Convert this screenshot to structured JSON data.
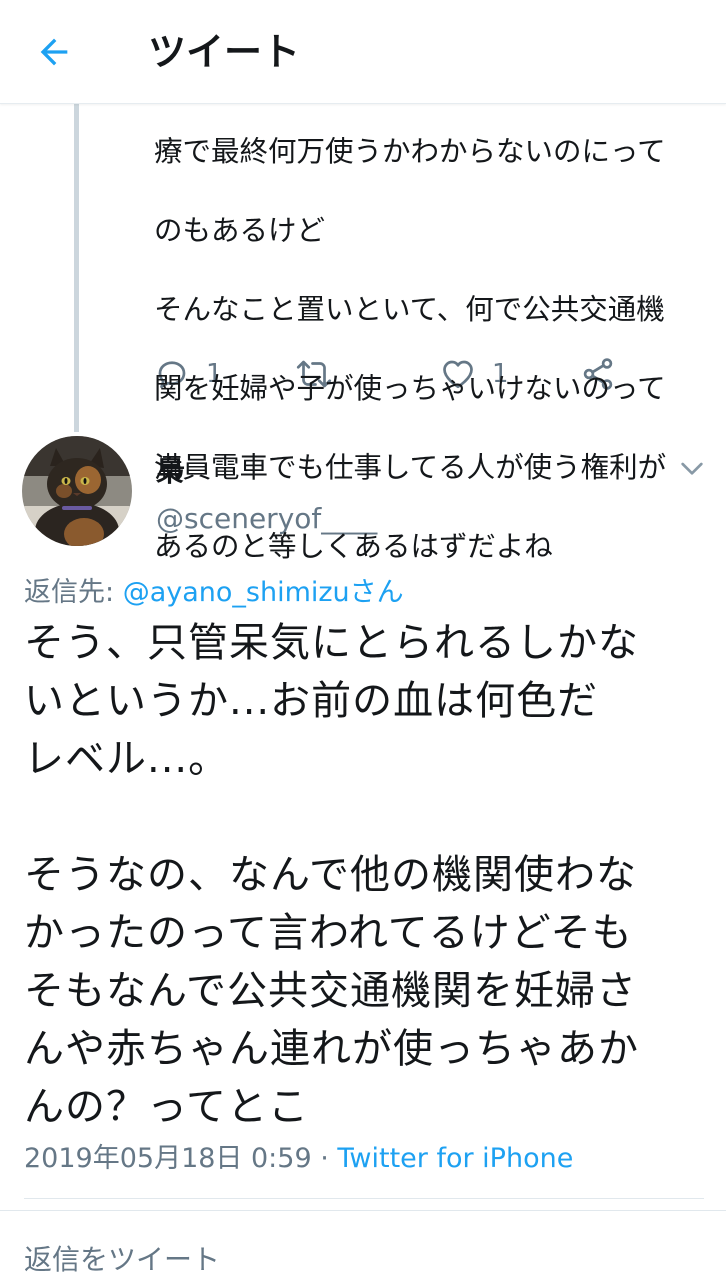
{
  "header": {
    "title": "ツイート",
    "back_icon": "arrow-left-icon",
    "accent_color": "#1da1f2"
  },
  "previous_tweet": {
    "text_lines": [
      "療で最終何万使うかわからないのにって",
      "のもあるけど",
      "そんなこと置いといて、何で公共交通機",
      "関を妊婦や子が使っちゃいけないのって",
      "満員電車でも仕事してる人が使う権利が",
      "あるのと等しくあるはずだよね"
    ],
    "actions": {
      "reply_count": "1",
      "retweet_count": "",
      "like_count": "1"
    }
  },
  "tweet": {
    "display_name": "梟",
    "handle": "@sceneryof____",
    "reply_to_prefix": "返信先: ",
    "reply_to_user": "@ayano_shimizu",
    "reply_to_suffix": "さん",
    "body": "そう、只管呆気にとられるしかな\nいというか...お前の血は何色だ\nレベル...。\n\nそうなの、なんで他の機関使わな\nかったのって言われてるけどそも\nそもなんで公共交通機関を妊婦さ\nんや赤ちゃん連れが使っちゃあか\nんの？ってとこ",
    "timestamp": "2019年05月18日 0:59",
    "separator": " · ",
    "source": "Twitter for iPhone"
  },
  "reply_box": {
    "placeholder": "返信をツイート"
  }
}
